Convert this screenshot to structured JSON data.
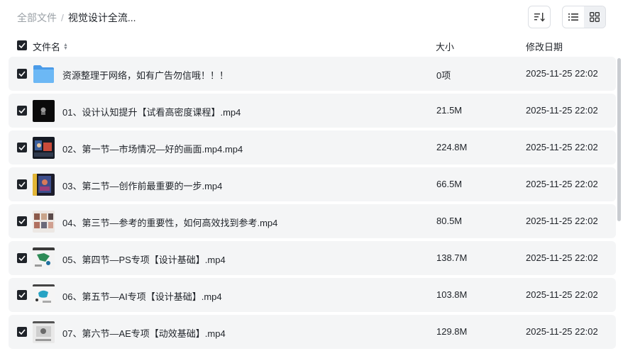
{
  "breadcrumb": {
    "root": "全部文件",
    "separator": "/",
    "current": "视觉设计全流..."
  },
  "toolbar": {
    "sort_icon": "sort-icon",
    "list_view_icon": "list-view-icon",
    "grid_view_icon": "grid-view-icon"
  },
  "columns": {
    "name": "文件名",
    "size": "大小",
    "date": "修改日期"
  },
  "files": [
    {
      "name": "资源整理于网络，如有广告勿信哦！！！",
      "size": "0项",
      "date": "2025-11-25 22:02",
      "type": "folder"
    },
    {
      "name": "01、设计认知提升【试看高密度课程】.mp4",
      "size": "21.5M",
      "date": "2025-11-25 22:02",
      "type": "video"
    },
    {
      "name": "02、第一节—市场情况—好的画面.mp4.mp4",
      "size": "224.8M",
      "date": "2025-11-25 22:02",
      "type": "video"
    },
    {
      "name": "03、第二节—创作前最重要的一步.mp4",
      "size": "66.5M",
      "date": "2025-11-25 22:02",
      "type": "video"
    },
    {
      "name": "04、第三节—参考的重要性，如何高效找到参考.mp4",
      "size": "80.5M",
      "date": "2025-11-25 22:02",
      "type": "video"
    },
    {
      "name": "05、第四节—PS专项【设计基础】.mp4",
      "size": "138.7M",
      "date": "2025-11-25 22:02",
      "type": "video"
    },
    {
      "name": "06、第五节—AI专项【设计基础】.mp4",
      "size": "103.8M",
      "date": "2025-11-25 22:02",
      "type": "video"
    },
    {
      "name": "07、第六节—AE专项【动效基础】.mp4",
      "size": "129.8M",
      "date": "2025-11-25 22:02",
      "type": "video"
    }
  ],
  "colors": {
    "row_bg": "#f4f5f6",
    "checkbox": "#1f2329",
    "folder": "#5aa9f0",
    "muted_text": "#9aa0a6"
  }
}
